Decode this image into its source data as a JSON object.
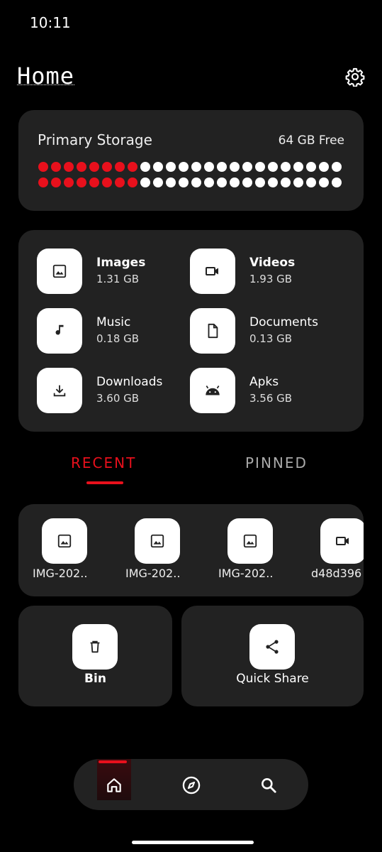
{
  "status_bar": {
    "time": "10:11"
  },
  "header": {
    "title": "Home",
    "settings_icon": "gear-icon"
  },
  "storage": {
    "label": "Primary Storage",
    "free": "64 GB Free",
    "used_fraction": 0.35,
    "used_color": "#e8101c"
  },
  "categories": [
    {
      "name": "Images",
      "size": "1.31 GB",
      "icon": "image-icon"
    },
    {
      "name": "Videos",
      "size": "1.93 GB",
      "icon": "video-icon"
    },
    {
      "name": "Music",
      "size": "0.18 GB",
      "icon": "music-note-icon"
    },
    {
      "name": "Documents",
      "size": "0.13 GB",
      "icon": "document-icon"
    },
    {
      "name": "Downloads",
      "size": "3.60 GB",
      "icon": "download-icon"
    },
    {
      "name": "Apks",
      "size": "3.56 GB",
      "icon": "android-icon"
    }
  ],
  "tabs": {
    "recent": "RECENT",
    "pinned": "PINNED",
    "active": "recent"
  },
  "recent": [
    {
      "name": "IMG-202..",
      "icon": "image-icon"
    },
    {
      "name": "IMG-202..",
      "icon": "image-icon"
    },
    {
      "name": "IMG-202..",
      "icon": "image-icon"
    },
    {
      "name": "d48d396",
      "icon": "video-icon"
    }
  ],
  "actions": {
    "bin": "Bin",
    "quick_share": "Quick Share"
  },
  "nav": {
    "active": "home"
  }
}
